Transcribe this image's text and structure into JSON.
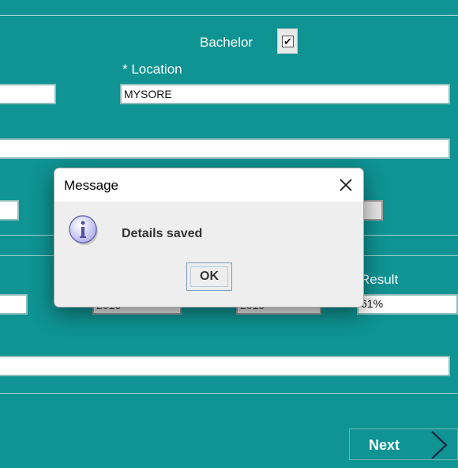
{
  "form": {
    "bachelor_label": "Bachelor",
    "bachelor_checked": true,
    "bachelor_check_glyph": "✔",
    "location_label": "* Location",
    "location_value": "MYSORE",
    "result_label": "Result",
    "year_from_value": "2016",
    "year_to_value": "2019",
    "result_value": "61%",
    "next_label": "Next"
  },
  "dialog": {
    "title": "Message",
    "message": "Details saved",
    "ok_label": "OK",
    "icon": "info-icon"
  },
  "colors": {
    "background": "#0f9393",
    "dialog_bg": "#eeeeee"
  }
}
